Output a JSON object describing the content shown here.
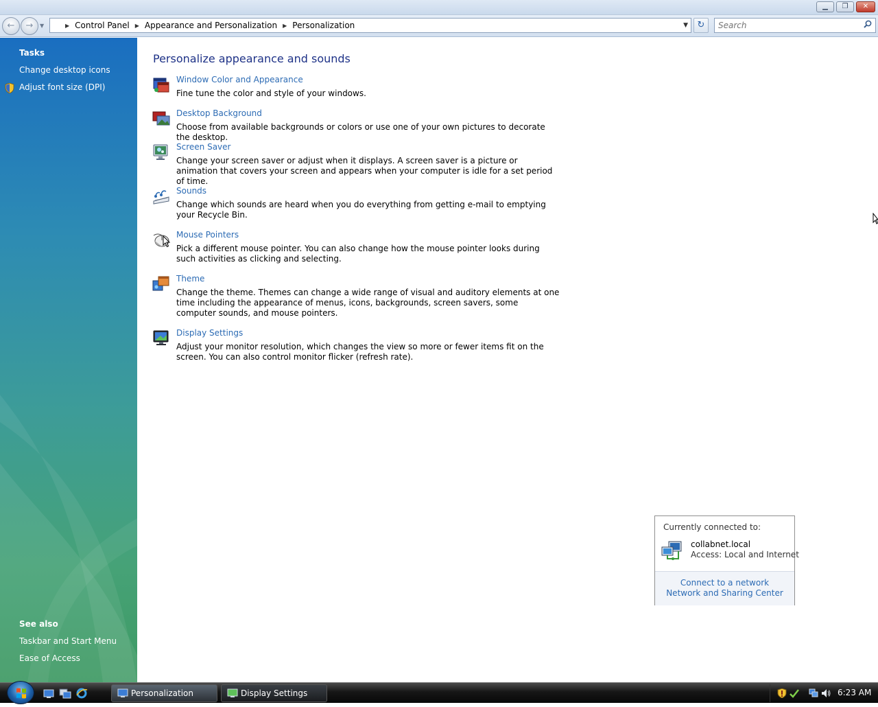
{
  "window": {
    "minimize_glyph": "▁",
    "maximize_glyph": "❐",
    "close_glyph": "✕"
  },
  "navigation": {
    "back_glyph": "←",
    "forward_glyph": "→",
    "history_dropdown_glyph": "▼",
    "breadcrumbs": [
      "Control Panel",
      "Appearance and Personalization",
      "Personalization"
    ],
    "breadcrumb_separator": "▶",
    "address_dropdown_glyph": "▼",
    "refresh_glyph": "↻",
    "search_placeholder": "Search",
    "search_icon": "magnifier-icon"
  },
  "sidebar": {
    "tasks_heading": "Tasks",
    "tasks": [
      {
        "label": "Change desktop icons"
      },
      {
        "label": "Adjust font size (DPI)",
        "icon": "uac-shield-icon"
      }
    ],
    "see_also_heading": "See also",
    "see_also": [
      {
        "label": "Taskbar and Start Menu"
      },
      {
        "label": "Ease of Access"
      }
    ]
  },
  "main": {
    "heading": "Personalize appearance and sounds",
    "items": [
      {
        "title": "Window Color and Appearance",
        "description": "Fine tune the color and style of your windows.",
        "icon": "window-color-icon"
      },
      {
        "title": "Desktop Background",
        "description": "Choose from available backgrounds or colors or use one of your own pictures to decorate the desktop.",
        "icon": "desktop-background-icon"
      },
      {
        "title": "Screen Saver",
        "description": "Change your screen saver or adjust when it displays. A screen saver is a picture or animation that covers your screen and appears when your computer is idle for a set period of time.",
        "icon": "screen-saver-icon"
      },
      {
        "title": "Sounds",
        "description": "Change which sounds are heard when you do everything from getting e-mail to emptying your Recycle Bin.",
        "icon": "sounds-icon"
      },
      {
        "title": "Mouse Pointers",
        "description": "Pick a different mouse pointer. You can also change how the mouse pointer looks during such activities as clicking and selecting.",
        "icon": "mouse-icon"
      },
      {
        "title": "Theme",
        "description": "Change the theme. Themes can change a wide range of visual and auditory elements at one time including the appearance of menus, icons, backgrounds, screen savers, some computer sounds, and mouse pointers.",
        "icon": "theme-icon"
      },
      {
        "title": "Display Settings",
        "description": "Adjust your monitor resolution, which changes the view so more or fewer items fit on the screen. You can also control monitor flicker (refresh rate).",
        "icon": "display-settings-icon"
      }
    ]
  },
  "network_popup": {
    "heading": "Currently connected to:",
    "network_name": "collabnet.local",
    "access": "Access:  Local and Internet",
    "links": [
      "Connect to a network",
      "Network and Sharing Center"
    ]
  },
  "taskbar": {
    "start_icon": "windows-orb-icon",
    "quick_launch": [
      "show-desktop-icon",
      "switch-windows-icon",
      "internet-explorer-icon"
    ],
    "buttons": [
      {
        "label": "Personalization",
        "active": true
      },
      {
        "label": "Display Settings",
        "active": false
      }
    ],
    "tray_icons": [
      "security-shield-icon",
      "security-check-icon",
      "network-icon",
      "volume-icon"
    ],
    "clock": "6:23 AM"
  },
  "colors": {
    "link": "#2c6bb4",
    "heading": "#1e3287",
    "sidebar_top": "#1a6ec0",
    "sidebar_bottom": "#3e9a63"
  }
}
